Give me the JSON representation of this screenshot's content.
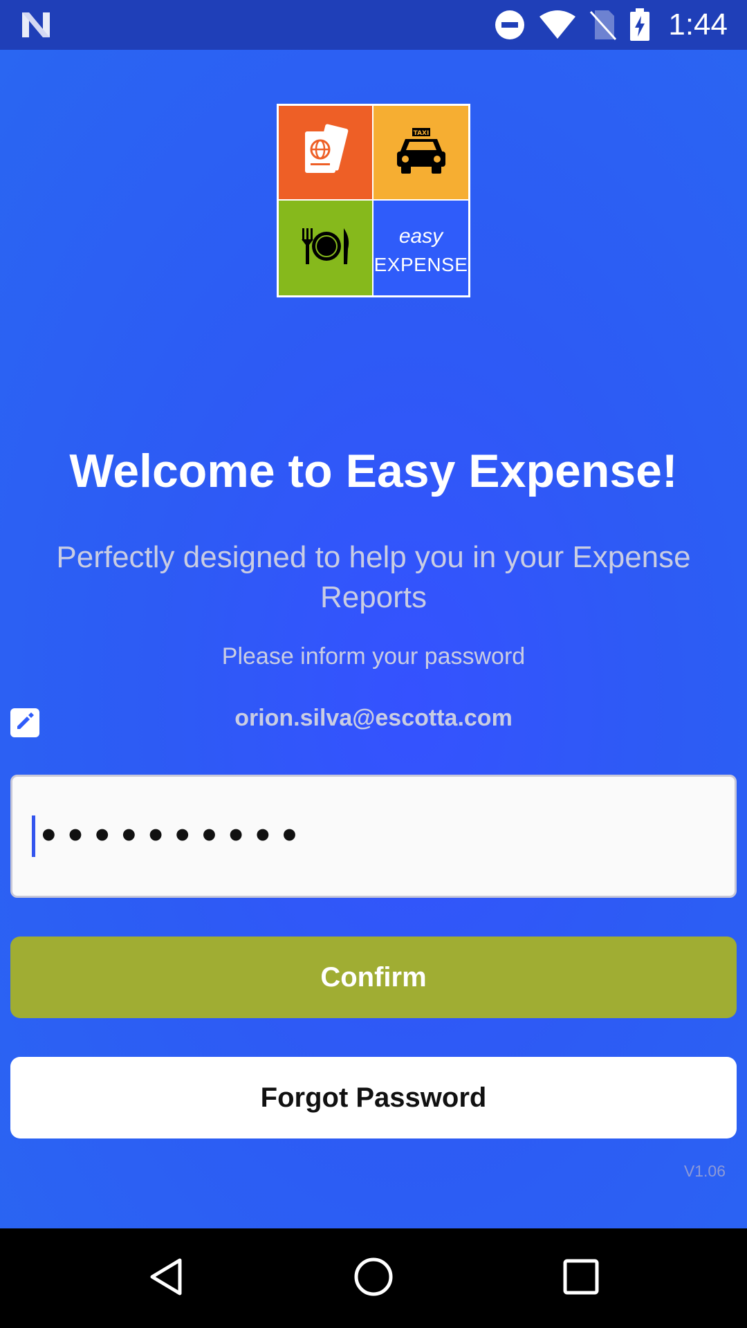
{
  "status_bar": {
    "time": "1:44",
    "icons": [
      "n-brand-icon",
      "do-not-disturb-icon",
      "wifi-icon",
      "no-sim-icon",
      "battery-charging-icon"
    ]
  },
  "logo": {
    "tiles": [
      "passport-icon",
      "taxi-icon",
      "plate-icon"
    ],
    "taxi_sign": "TAXI",
    "brand_line1": "easy",
    "brand_line2": "EXPENSE",
    "colors": {
      "travel": "#ee5f26",
      "taxi": "#f6ae32",
      "food": "#86b91c",
      "brand": "#2f5cfa"
    }
  },
  "welcome": {
    "title": "Welcome to Easy Expense!",
    "subtitle": "Perfectly designed to help you in your Expense Reports",
    "prompt": "Please inform your password"
  },
  "account": {
    "email": "orion.silva@escotta.com"
  },
  "password": {
    "value": "••••••••••"
  },
  "actions": {
    "confirm_label": "Confirm",
    "forgot_label": "Forgot Password"
  },
  "version": "V1.06",
  "colors": {
    "confirm_button": "#a0ad33",
    "background": "#2d5bf4"
  },
  "nav": [
    "back-icon",
    "home-icon",
    "recents-icon"
  ]
}
